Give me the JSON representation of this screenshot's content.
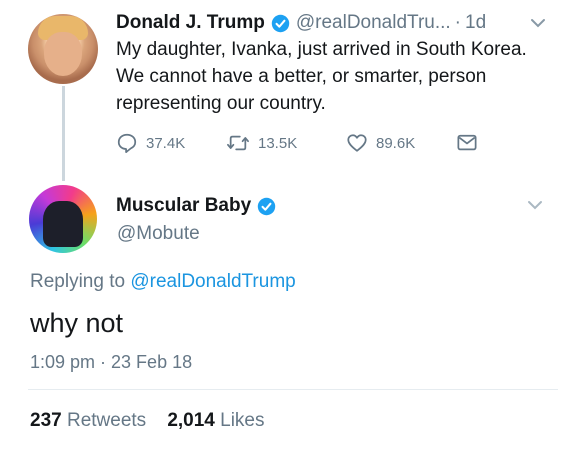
{
  "parent_tweet": {
    "display_name": "Donald J. Trump",
    "handle": "@realDonaldTru...",
    "separator": "·",
    "age": "1d",
    "text": "My daughter, Ivanka, just arrived in South Korea. We cannot have a better, or smarter, person representing our country.",
    "replies": "37.4K",
    "retweets": "13.5K",
    "likes": "89.6K"
  },
  "reply_tweet": {
    "display_name": "Muscular Baby",
    "handle": "@Mobute",
    "replying_prefix": "Replying to",
    "replying_to": "@realDonaldTrump",
    "text": "why not",
    "timestamp": "1:09 pm · 23 Feb 18",
    "retweet_count": "237",
    "retweet_label": "Retweets",
    "like_count": "2,014",
    "like_label": "Likes"
  },
  "colors": {
    "verified": "#1da1f2",
    "link": "#1b95e0",
    "muted": "#657786",
    "text": "#14171a"
  },
  "icons": [
    "verified-badge-icon",
    "chevron-down-icon",
    "reply-icon",
    "retweet-icon",
    "like-icon",
    "direct-message-icon"
  ]
}
